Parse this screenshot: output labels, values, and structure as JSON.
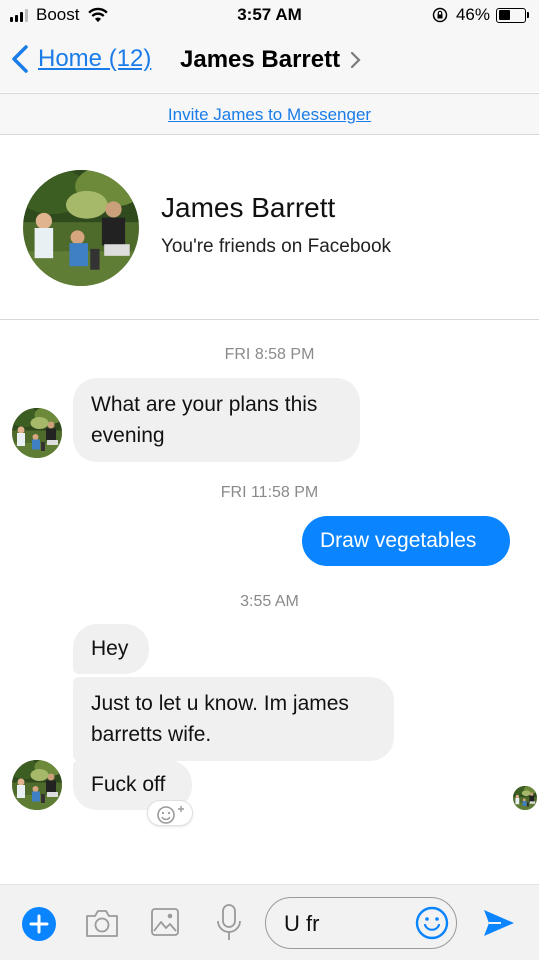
{
  "status_bar": {
    "carrier": "Boost",
    "time": "3:57 AM",
    "battery": "46%",
    "battery_level": 0.46
  },
  "nav": {
    "back_label": "Home (12)",
    "title": "James Barrett"
  },
  "invite": {
    "label": "Invite James to Messenger"
  },
  "profile": {
    "name": "James Barrett",
    "subtitle": "You're friends on Facebook"
  },
  "messages": {
    "ts1": "FRI 8:58 PM",
    "m1": "What are your plans this evening",
    "ts2": "FRI 11:58 PM",
    "m2": "Draw vegetables",
    "ts3": "3:55 AM",
    "m3": "Hey",
    "m4": "Just to let u know. Im james barretts wife.",
    "m5": "Fuck off"
  },
  "composer": {
    "input_value": "U fr"
  },
  "colors": {
    "accent": "#1a7ce8",
    "outgoing_bubble": "#0a84ff",
    "incoming_bubble": "#f1f0f0",
    "timestamp": "#8a8a8a"
  },
  "icons": [
    "signal-icon",
    "wifi-icon",
    "orientation-lock-icon",
    "battery-icon",
    "chevron-left-icon",
    "chevron-right-icon",
    "plus-icon",
    "camera-icon",
    "image-icon",
    "microphone-icon",
    "emoji-icon",
    "send-icon",
    "add-reaction-icon"
  ]
}
